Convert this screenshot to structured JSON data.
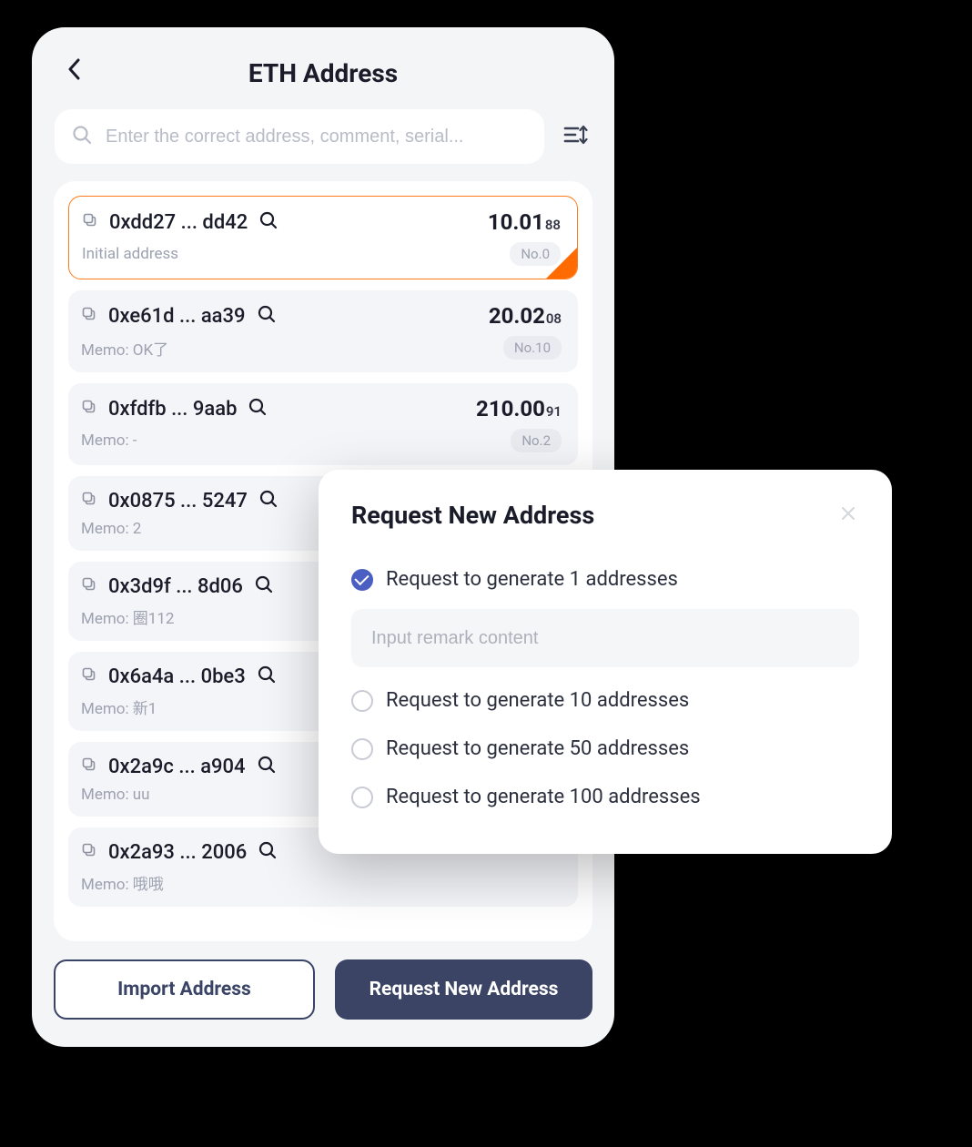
{
  "header": {
    "title": "ETH Address"
  },
  "search": {
    "placeholder": "Enter the correct address, comment, serial..."
  },
  "addresses": [
    {
      "addr": "0xdd27 ... dd42",
      "balance_main": "10.01",
      "balance_sub": "88",
      "memo": "Initial address",
      "serial": "No.0",
      "selected": true
    },
    {
      "addr": "0xe61d ... aa39",
      "balance_main": "20.02",
      "balance_sub": "08",
      "memo": "Memo: OK了",
      "serial": "No.10",
      "selected": false
    },
    {
      "addr": "0xfdfb ... 9aab",
      "balance_main": "210.00",
      "balance_sub": "91",
      "memo": "Memo: -",
      "serial": "No.2",
      "selected": false
    },
    {
      "addr": "0x0875 ... 5247",
      "balance_main": "",
      "balance_sub": "",
      "memo": "Memo: 2",
      "serial": "",
      "selected": false
    },
    {
      "addr": "0x3d9f ... 8d06",
      "balance_main": "",
      "balance_sub": "",
      "memo": "Memo: 圈112",
      "serial": "",
      "selected": false
    },
    {
      "addr": "0x6a4a ... 0be3",
      "balance_main": "",
      "balance_sub": "",
      "memo": "Memo: 新1",
      "serial": "",
      "selected": false
    },
    {
      "addr": "0x2a9c ... a904",
      "balance_main": "",
      "balance_sub": "",
      "memo": "Memo: uu",
      "serial": "",
      "selected": false
    },
    {
      "addr": "0x2a93 ... 2006",
      "balance_main": "",
      "balance_sub": "",
      "memo": "Memo: 哦哦",
      "serial": "",
      "selected": false
    }
  ],
  "footer": {
    "import_label": "Import Address",
    "request_label": "Request New Address"
  },
  "modal": {
    "title": "Request New Address",
    "remark_placeholder": "Input remark content",
    "options": [
      {
        "label": "Request to generate 1 addresses",
        "checked": true
      },
      {
        "label": "Request to generate 10 addresses",
        "checked": false
      },
      {
        "label": "Request to generate 50 addresses",
        "checked": false
      },
      {
        "label": "Request to generate 100 addresses",
        "checked": false
      }
    ]
  }
}
